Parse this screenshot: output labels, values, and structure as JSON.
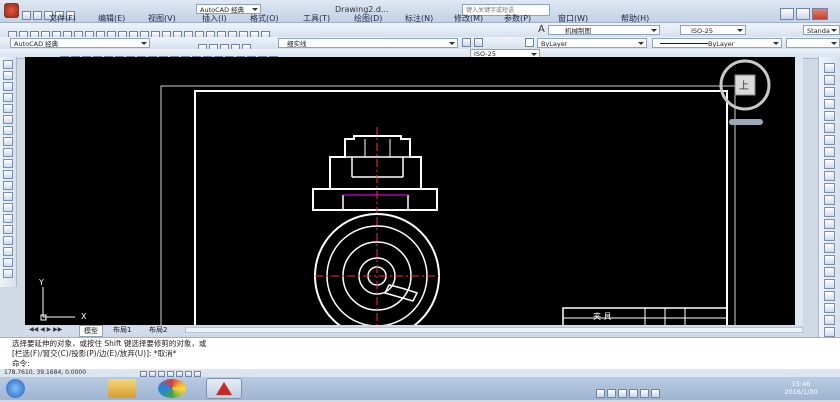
{
  "title": {
    "app_combo": "AutoCAD 经典",
    "doc_title": "Drawing2.d...",
    "search_placeholder": "键入关键字或短语"
  },
  "menu": [
    "文件(F)",
    "编辑(E)",
    "视图(V)",
    "插入(I)",
    "格式(O)",
    "工具(T)",
    "绘图(D)",
    "标注(N)",
    "修改(M)",
    "参数(P)",
    "窗口(W)",
    "帮助(H)"
  ],
  "toolbar": {
    "workspace": "AutoCAD 经典",
    "layer": "细实线",
    "text_style": "机械制图",
    "dim_style": "ISO-25",
    "dim_style_2": "ISO-25",
    "color": "ByLayer",
    "linetype": "ByLayer",
    "plot_style": "Standa"
  },
  "tabs": [
    "模型",
    "布局1",
    "布局2"
  ],
  "command": {
    "line1": "选择要延伸的对象，或按住 Shift 键选择要修剪的对象，或",
    "line2": "[栏选(F)/窗交(C)/投影(P)/边(E)/放弃(U)]:  *取消*",
    "prompt": "命令:"
  },
  "status": {
    "coords": "178.7610, 39.1684, 0.0000"
  },
  "titleblock": {
    "label": "夹 具"
  },
  "viewcube": {
    "face": "上"
  },
  "ucs": {
    "x": "X",
    "y": "Y"
  },
  "clock": {
    "time": "15:46",
    "date": "2016/1/30"
  }
}
